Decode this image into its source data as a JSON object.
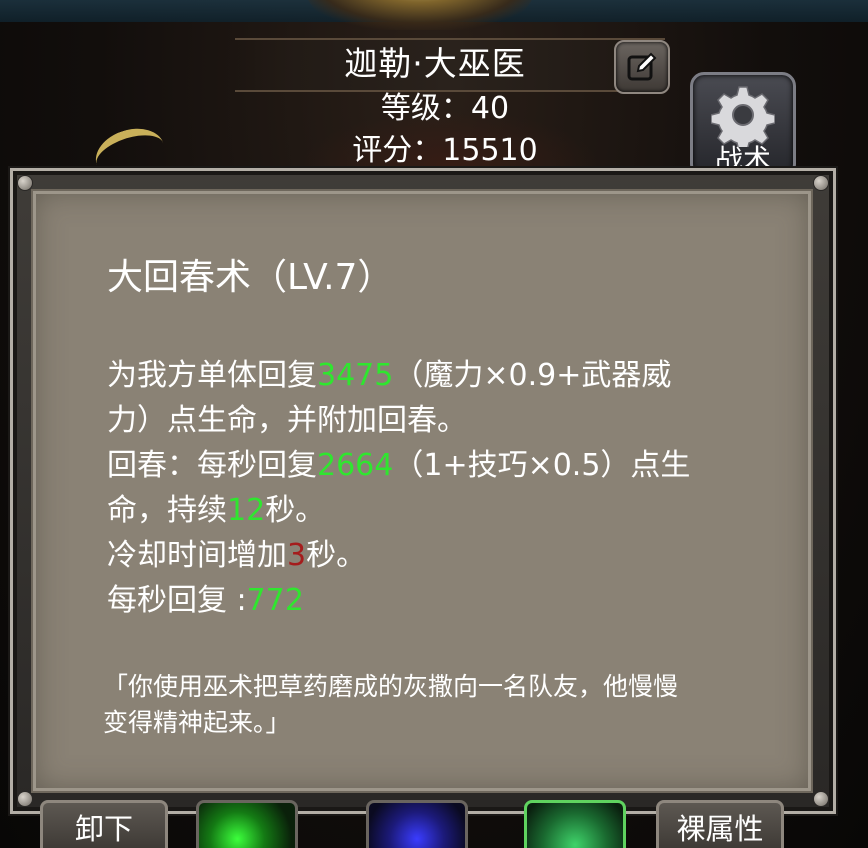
{
  "header": {
    "hero_name": "迦勒·大巫医",
    "level_text": "等级：40",
    "score_text": "评分：15510",
    "tactics_label": "战术"
  },
  "skill": {
    "title": "大回春术（LV.7）",
    "lines": [
      {
        "a": "为我方单体回复",
        "v": "3475",
        "b": "（魔力×0.9+武器威"
      },
      {
        "a": "力）点生命，并附加回春。"
      },
      {
        "a": "回春：每秒回复",
        "v": "2664",
        "b": "（1+技巧×0.5）点生"
      },
      {
        "a": "命，持续",
        "v": "12",
        "b": "秒。"
      },
      {
        "a": "冷却时间增加",
        "v": "3",
        "b": "秒。"
      },
      {
        "a": "每秒回复 :",
        "v": "772"
      }
    ],
    "flavor_lines": [
      "「你使用巫术把草药磨成的灰撒向一名队友，他慢慢",
      "变得精神起来。」"
    ]
  },
  "bottom": {
    "unequip_label": "卸下",
    "base_attr_label": "裸属性"
  },
  "colors": {
    "value_green": "#2fe62f",
    "value_red": "#a51c1c",
    "panel_bg": "#8a8275"
  },
  "icons": [
    "edit-icon",
    "gear-icon"
  ]
}
